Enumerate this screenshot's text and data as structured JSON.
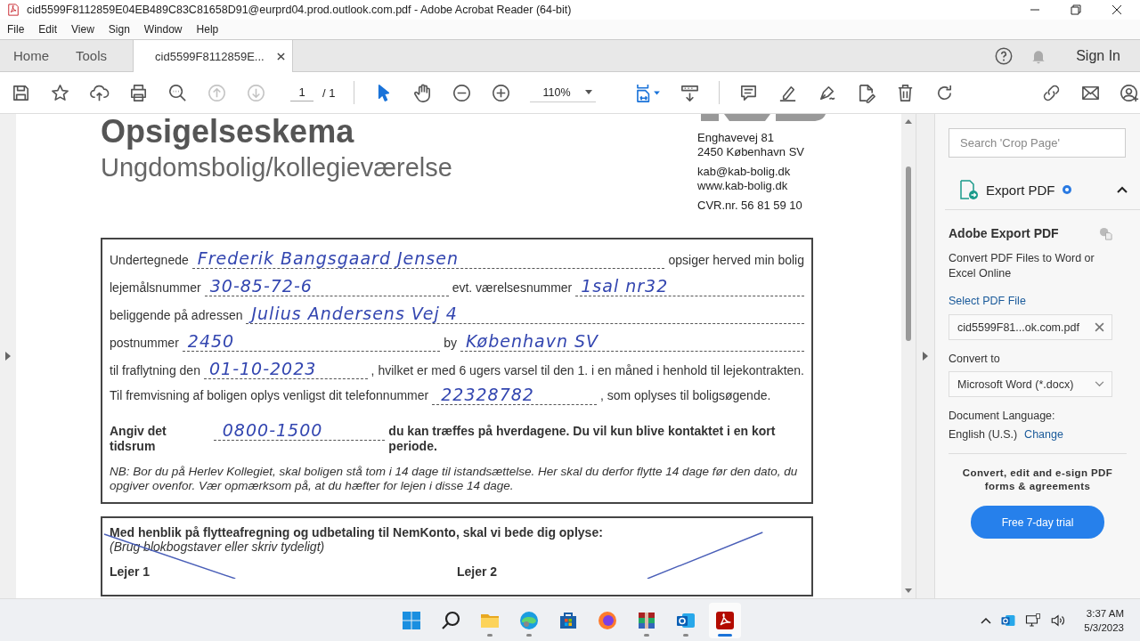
{
  "window": {
    "title": "cid5599F8112859E04EB489C83C81658D91@eurprd04.prod.outlook.com.pdf - Adobe Acrobat Reader (64-bit)"
  },
  "menu": [
    "File",
    "Edit",
    "View",
    "Sign",
    "Window",
    "Help"
  ],
  "tabs": [
    {
      "label": "Home",
      "selected": false,
      "closable": false
    },
    {
      "label": "Tools",
      "selected": false,
      "closable": false
    },
    {
      "label": "cid5599F8112859E...",
      "selected": true,
      "closable": true
    }
  ],
  "sign_in": "Sign In",
  "toolbar": {
    "nav": [
      {
        "kind": "save",
        "disabled": false
      },
      {
        "kind": "star",
        "disabled": false
      },
      {
        "kind": "upload",
        "disabled": false
      },
      {
        "kind": "print",
        "disabled": false
      },
      {
        "kind": "find",
        "disabled": false
      },
      {
        "kind": "prev",
        "disabled": true
      },
      {
        "kind": "next",
        "disabled": true
      }
    ],
    "page": "1",
    "page_total": "/ 1",
    "tools": [
      {
        "kind": "select",
        "selected": true
      },
      {
        "kind": "hand",
        "selected": false
      },
      {
        "kind": "zoom-out",
        "selected": false
      },
      {
        "kind": "zoom-in",
        "selected": false
      }
    ],
    "zoom": "110%",
    "actions": [
      {
        "kind": "fit",
        "selected": true
      },
      {
        "kind": "scroll",
        "selected": false
      },
      {
        "kind": "comment",
        "selected": false
      },
      {
        "kind": "highlight",
        "selected": false
      },
      {
        "kind": "sign",
        "selected": false
      },
      {
        "kind": "edit",
        "selected": false
      },
      {
        "kind": "delete",
        "selected": false
      },
      {
        "kind": "rotate",
        "selected": false
      }
    ],
    "share": [
      {
        "kind": "link"
      },
      {
        "kind": "mail"
      },
      {
        "kind": "user-add"
      }
    ]
  },
  "document": {
    "title": "Opsigelseskema",
    "subtitle": "Ungdomsbolig/kollegieværelse",
    "address": [
      "Enghavevej 81",
      "2450 København SV"
    ],
    "contact": [
      "kab@kab-bolig.dk",
      "www.kab-bolig.dk"
    ],
    "cvr": "CVR.nr. 56 81 59 10",
    "form_rows": [
      {
        "kind": "line",
        "bold": false,
        "parts": [
          {
            "kind": "text",
            "text": "Undertegnede"
          },
          {
            "kind": "fill",
            "text": "Frederik Bangsgaard Jensen"
          },
          {
            "kind": "text",
            "text": "opsiger herved min bolig"
          }
        ]
      },
      {
        "kind": "line",
        "bold": false,
        "parts": [
          {
            "kind": "text",
            "text": "lejemålsnummer"
          },
          {
            "kind": "fill",
            "text": "30-85-72-6"
          },
          {
            "kind": "text",
            "text": "evt. værelsesnummer"
          },
          {
            "kind": "fill",
            "text": "1sal nr32"
          }
        ]
      },
      {
        "kind": "line",
        "bold": false,
        "parts": [
          {
            "kind": "text",
            "text": "beliggende på adressen"
          },
          {
            "kind": "fill",
            "text": "Julius Andersens Vej 4"
          }
        ]
      },
      {
        "kind": "line",
        "bold": false,
        "parts": [
          {
            "kind": "text",
            "text": "postnummer"
          },
          {
            "kind": "fill",
            "text": "2450"
          },
          {
            "kind": "text",
            "text": "by"
          },
          {
            "kind": "fill",
            "text": "København SV"
          }
        ]
      },
      {
        "kind": "line",
        "bold": false,
        "parts": [
          {
            "kind": "text",
            "text": "til fraflytning den"
          },
          {
            "kind": "fill",
            "text": "01-10-2023"
          },
          {
            "kind": "text",
            "text": ", hvilket er med 6 ugers varsel til den 1. i en måned i henhold til lejekontrakten."
          }
        ]
      },
      {
        "kind": "wrap",
        "bold": false,
        "parts": [
          {
            "kind": "text",
            "text": "Til fremvisning af boligen oplys venligst dit telefonnummer"
          },
          {
            "kind": "fill",
            "text": "22328782"
          },
          {
            "kind": "text",
            "text": ", som oplyses til boligsøgende."
          }
        ]
      },
      {
        "kind": "wrap",
        "bold": true,
        "parts": [
          {
            "kind": "text",
            "text": "Angiv det tidsrum"
          },
          {
            "kind": "fill",
            "text": "0800-1500"
          },
          {
            "kind": "text",
            "text": "du kan træffes på hverdagene. Du vil kun blive kontaktet i en kort periode."
          }
        ]
      }
    ],
    "note": "NB: Bor du på Herlev Kollegiet, skal boligen stå tom i 14 dage til istandsættelse. Her skal du derfor flytte 14 dage før den dato, du opgiver ovenfor. Vær opmærksom på, at du hæfter for lejen i disse 14 dage.",
    "section2": {
      "heading": "Med henblik på flytteafregning og udbetaling til NemKonto, skal vi bede dig oplyse:",
      "hint": "(Brug blokbogstaver eller skriv tydeligt)",
      "columns": [
        "Lejer 1",
        "Lejer 2"
      ]
    }
  },
  "search": {
    "placeholder": "Search 'Crop Page'"
  },
  "export": {
    "title": "Export PDF",
    "expanded": true,
    "heading": "Adobe Export PDF",
    "description": "Convert PDF Files to Word or Excel Online",
    "select_label": "Select PDF File",
    "file": "cid5599F81...ok.com.pdf",
    "convert_label": "Convert to",
    "format": "Microsoft Word (*.docx)",
    "language_label": "Document Language:",
    "language": "English (U.S.)",
    "change": "Change"
  },
  "promo": {
    "text": "Convert, edit and e-sign PDF forms & agreements",
    "button": "Free 7-day trial"
  },
  "taskbar": {
    "apps": [
      {
        "kind": "start",
        "running": false,
        "selected": false
      },
      {
        "kind": "search",
        "running": false,
        "selected": false
      },
      {
        "kind": "folder",
        "running": true,
        "selected": false
      },
      {
        "kind": "edge",
        "running": true,
        "selected": false
      },
      {
        "kind": "store",
        "running": false,
        "selected": false
      },
      {
        "kind": "firefox",
        "running": false,
        "selected": false
      },
      {
        "kind": "archive",
        "running": true,
        "selected": false
      },
      {
        "kind": "outlook",
        "running": true,
        "selected": false
      },
      {
        "kind": "acrobat",
        "running": true,
        "selected": true
      }
    ],
    "time": "3:37 AM",
    "date": "5/3/2023"
  }
}
